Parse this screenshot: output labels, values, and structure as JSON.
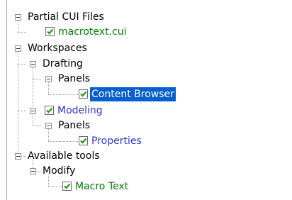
{
  "tree": {
    "nodes": [
      {
        "label": "Partial CUI Files",
        "color": "black",
        "checkbox": false,
        "expanded": true
      },
      {
        "label": "macrotext.cui",
        "color": "green",
        "checkbox": true
      },
      {
        "label": "Workspaces",
        "color": "black",
        "checkbox": false,
        "expanded": true
      },
      {
        "label": "Drafting",
        "color": "black",
        "checkbox": false,
        "expanded": true
      },
      {
        "label": "Panels",
        "color": "black",
        "checkbox": false,
        "expanded": true
      },
      {
        "label": "Content Browser",
        "color": "selected",
        "checkbox": true,
        "selected": true
      },
      {
        "label": "Modeling",
        "color": "blue",
        "checkbox": true,
        "expanded": true
      },
      {
        "label": "Panels",
        "color": "black",
        "checkbox": false,
        "expanded": true
      },
      {
        "label": "Properties",
        "color": "blue",
        "checkbox": true
      },
      {
        "label": "Available tools",
        "color": "black",
        "checkbox": false,
        "expanded": true
      },
      {
        "label": "Modify",
        "color": "black",
        "checkbox": false,
        "expanded": true
      },
      {
        "label": "Macro Text",
        "color": "green",
        "checkbox": true
      }
    ]
  },
  "colors": {
    "black": "#000000",
    "green": "#008000",
    "blue": "#3333cc",
    "selection": "#0a5fd0",
    "check": "#1a9a1a"
  }
}
